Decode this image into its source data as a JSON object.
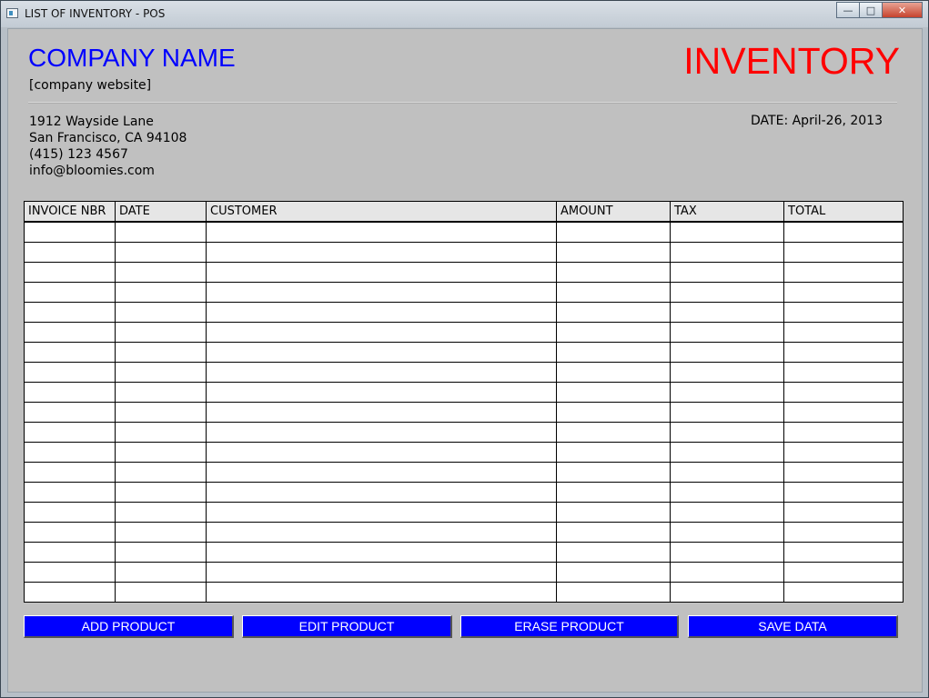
{
  "window": {
    "title": "LIST OF INVENTORY - POS",
    "controls": {
      "minimize": "—",
      "maximize": "□",
      "close": "✕"
    }
  },
  "header": {
    "company_name": "COMPANY NAME",
    "company_website": "[company website]",
    "doc_title": "INVENTORY",
    "address_lines": [
      "1912 Wayside Lane",
      "San Francisco, CA 94108",
      "(415) 123 4567",
      "info@bloomies.com"
    ],
    "date": "DATE: April-26, 2013"
  },
  "table": {
    "columns": [
      "INVOICE NBR",
      "DATE",
      "CUSTOMER",
      "AMOUNT",
      "TAX",
      "TOTAL"
    ],
    "empty_row_count": 19
  },
  "buttons": {
    "add": "ADD PRODUCT",
    "edit": "EDIT PRODUCT",
    "erase": "ERASE PRODUCT",
    "save": "SAVE DATA"
  },
  "colors": {
    "company_name": "#0000ff",
    "doc_title": "#ff0000",
    "button_bg": "#0000ff",
    "button_text": "#ffffff",
    "panel_bg": "#c0c0c0"
  }
}
